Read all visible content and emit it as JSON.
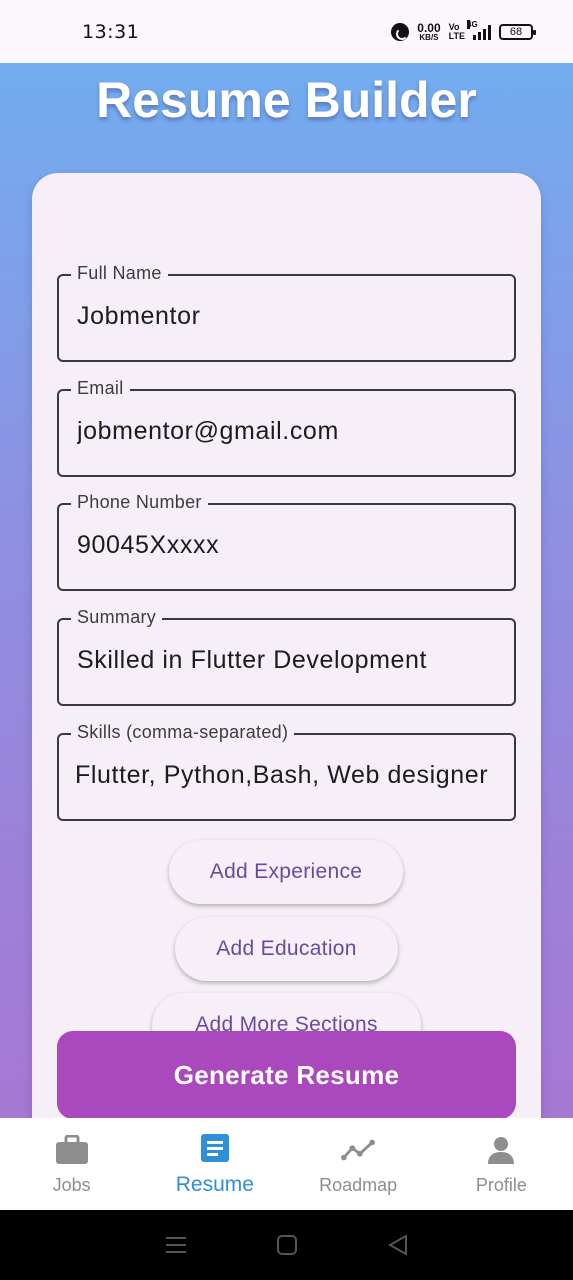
{
  "status_bar": {
    "time": "13:31",
    "net_speed_value": "0.00",
    "net_speed_unit": "KB/S",
    "volte_top": "Vo",
    "volte_bottom": "LTE",
    "signal_label": "4G",
    "battery": "68"
  },
  "app": {
    "title": "Resume Builder"
  },
  "form": {
    "full_name": {
      "label": "Full Name",
      "value": "Jobmentor"
    },
    "email": {
      "label": "Email",
      "value": "jobmentor@gmail.com"
    },
    "phone": {
      "label": "Phone Number",
      "value": "90045Xxxxx"
    },
    "summary": {
      "label": "Summary",
      "value": "Skilled in Flutter Development"
    },
    "skills": {
      "label": "Skills (comma-separated)",
      "value": "Flutter, Python,Bash, Web designer"
    }
  },
  "actions": {
    "add_experience": "Add Experience",
    "add_education": "Add Education",
    "add_more_sections": "Add More Sections",
    "generate": "Generate Resume"
  },
  "bottom_nav": {
    "items": [
      {
        "label": "Jobs",
        "icon": "briefcase-icon",
        "active": false
      },
      {
        "label": "Resume",
        "icon": "document-icon",
        "active": true
      },
      {
        "label": "Roadmap",
        "icon": "roadmap-icon",
        "active": false
      },
      {
        "label": "Profile",
        "icon": "person-icon",
        "active": false
      }
    ]
  },
  "colors": {
    "accent": "#aa48bd",
    "nav_active": "#2f8fd8",
    "pill_text": "#6a4aa0"
  }
}
